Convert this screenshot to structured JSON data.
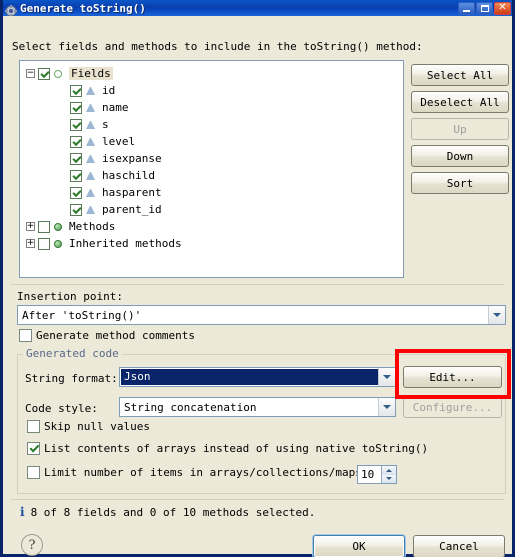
{
  "window": {
    "title": "Generate toString()",
    "icon": "gear-icon",
    "controls": {
      "minimize": "minimize",
      "maximize": "maximize",
      "close": "close"
    }
  },
  "header": {
    "label": "Select fields and methods to include in the toString() method:"
  },
  "tree": {
    "nodes": [
      {
        "label": "Fields",
        "level": 0,
        "expander": "minus",
        "checked": true,
        "icon": "circle-hollow-icon",
        "selected": true
      },
      {
        "label": "id",
        "level": 1,
        "expander": "none",
        "checked": true,
        "icon": "field-triangle-icon",
        "selected": false
      },
      {
        "label": "name",
        "level": 1,
        "expander": "none",
        "checked": true,
        "icon": "field-triangle-icon",
        "selected": false
      },
      {
        "label": "s",
        "level": 1,
        "expander": "none",
        "checked": true,
        "icon": "field-triangle-icon",
        "selected": false
      },
      {
        "label": "level",
        "level": 1,
        "expander": "none",
        "checked": true,
        "icon": "field-triangle-icon",
        "selected": false
      },
      {
        "label": "isexpanse",
        "level": 1,
        "expander": "none",
        "checked": true,
        "icon": "field-triangle-icon",
        "selected": false
      },
      {
        "label": "haschild",
        "level": 1,
        "expander": "none",
        "checked": true,
        "icon": "field-triangle-icon",
        "selected": false
      },
      {
        "label": "hasparent",
        "level": 1,
        "expander": "none",
        "checked": true,
        "icon": "field-triangle-icon",
        "selected": false
      },
      {
        "label": "parent_id",
        "level": 1,
        "expander": "none",
        "checked": true,
        "icon": "field-triangle-icon",
        "selected": false
      },
      {
        "label": "Methods",
        "level": 0,
        "expander": "plus",
        "checked": false,
        "icon": "circle-green-icon",
        "selected": false
      },
      {
        "label": "Inherited methods",
        "level": 0,
        "expander": "plus",
        "checked": false,
        "icon": "circle-green-icon",
        "selected": false
      }
    ]
  },
  "side_buttons": [
    {
      "label": "Select All",
      "disabled": false
    },
    {
      "label": "Deselect All",
      "disabled": false
    },
    {
      "label": "Up",
      "disabled": true
    },
    {
      "label": "Down",
      "disabled": false
    },
    {
      "label": "Sort",
      "disabled": false
    }
  ],
  "insertion": {
    "label": "Insertion point:",
    "value": "After 'toString()'"
  },
  "generate_comments": {
    "label": "Generate method comments",
    "checked": false
  },
  "generated_code": {
    "group_label": "Generated code",
    "string_format": {
      "label": "String format:",
      "value": "Json",
      "selected": true,
      "edit_button": "Edit..."
    },
    "code_style": {
      "label": "Code style:",
      "value": "String concatenation",
      "configure_button": "Configure...",
      "configure_disabled": true
    },
    "options": [
      {
        "label": "Skip null values",
        "checked": false
      },
      {
        "label": "List contents of arrays instead of using native toString()",
        "checked": true
      },
      {
        "label": "Limit number of items in arrays/collections/maps to",
        "checked": false
      }
    ],
    "limit_value": "10"
  },
  "status": {
    "icon": "info-icon",
    "text": "8 of 8 fields and 0 of 10 methods selected."
  },
  "footer": {
    "help": "?",
    "ok": "OK",
    "cancel": "Cancel"
  },
  "annotation": {
    "type": "red-rectangle-highlight",
    "color": "#ff0000",
    "target": "edit-button"
  },
  "colors": {
    "dialog_bg": "#ece9d8",
    "titlebar": "#0a46bd",
    "selection": "#0a246a",
    "highlight": "#ff0000",
    "group_label": "#5a6a8a"
  }
}
